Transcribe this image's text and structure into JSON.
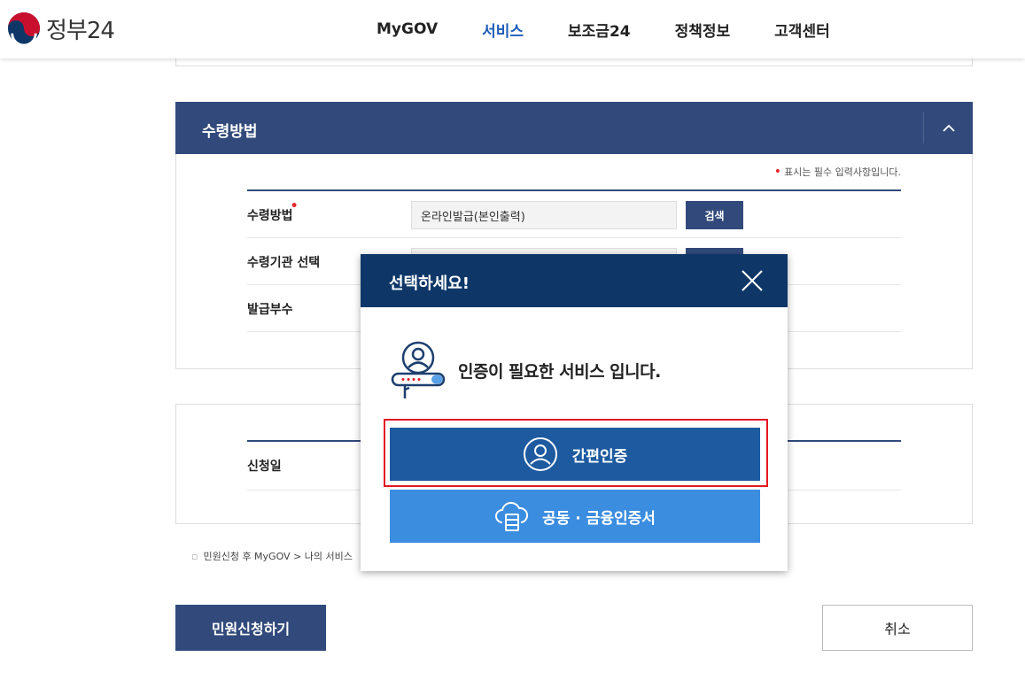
{
  "header": {
    "logo_text": "정부24",
    "nav": [
      {
        "label": "MyGOV"
      },
      {
        "label": "서비스"
      },
      {
        "label": "보조금24"
      },
      {
        "label": "정책정보"
      },
      {
        "label": "고객센터"
      }
    ]
  },
  "section1": {
    "title": "수령방법",
    "required_note": "표시는 필수 입력사항입니다.",
    "rows": [
      {
        "label": "수령방법",
        "value": "온라인발급(본인출력)",
        "button": "검색"
      },
      {
        "label": "수령기관 선택"
      },
      {
        "label": "발급부수"
      }
    ]
  },
  "section2": {
    "rows": [
      {
        "label": "신청일"
      }
    ]
  },
  "notice": "민원신청 후 MyGOV > 나의 서비스",
  "actions": {
    "apply": "민원신청하기",
    "cancel": "취소"
  },
  "modal": {
    "title": "선택하세요!",
    "message": "인증이 필요한 서비스 입니다.",
    "option1": "간편인증",
    "option2": "공동 · 금융인증서"
  },
  "colors": {
    "navy": "#324a7b",
    "modal_head": "#0e3768",
    "auth_primary": "#1d5aa0",
    "auth_secondary": "#3b8de0",
    "highlight": "#e3191f",
    "nav_active": "#1e5db8"
  }
}
